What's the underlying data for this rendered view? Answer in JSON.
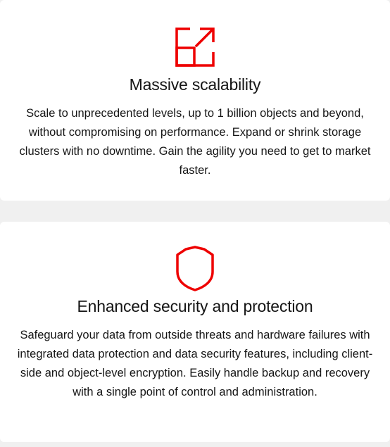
{
  "features": [
    {
      "icon": "expand-arrows-icon",
      "title": "Massive scalability",
      "description": "Scale to unprecedented levels, up to 1 billion objects and beyond, without compromising on performance. Expand or shrink storage clusters with no downtime. Gain the agility you need to get to market faster."
    },
    {
      "icon": "shield-icon",
      "title": "Enhanced security and protection",
      "description": "Safeguard your data from outside threats and hardware failures with integrated data protection and data security features, including client-side and object-level encryption. Easily handle backup and recovery with a single point of control and administration."
    }
  ],
  "colors": {
    "accent": "#ee0000",
    "text": "#151515",
    "card": "#ffffff",
    "background": "#f0f0f0"
  }
}
